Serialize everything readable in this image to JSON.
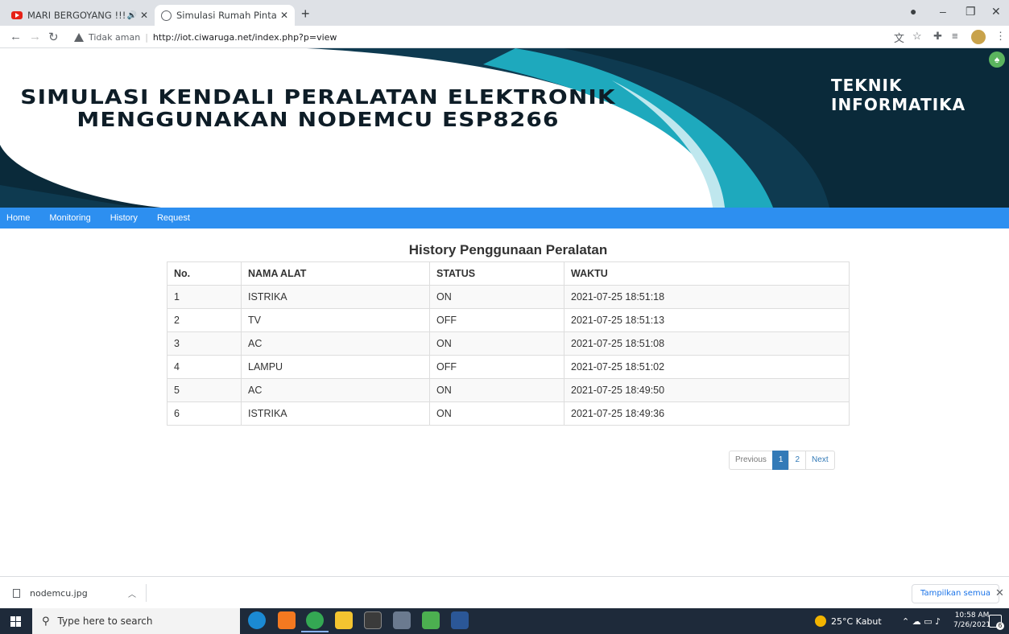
{
  "browser": {
    "tabs": [
      {
        "title": "MARI BERGOYANG !!! KOMP",
        "icon": "youtube-icon",
        "audio": true
      },
      {
        "title": "Simulasi Rumah Pintar Dengan N",
        "icon": "globe-icon",
        "active": true
      }
    ],
    "security_label": "Tidak aman",
    "url": "http://iot.ciwaruga.net/index.php?p=view"
  },
  "header": {
    "title_line1": "SIMULASI KENDALI PERALATAN ELEKTRONIK",
    "title_line2": "MENGGUNAKAN NODEMCU ESP8266",
    "brand_line1": "TEKNIK",
    "brand_line2": "INFORMATIKA",
    "colors": {
      "navy": "#0e3a50",
      "teal": "#1ea9bd",
      "dark": "#0a2a3a"
    }
  },
  "menu": {
    "items": [
      "Home",
      "Monitoring",
      "History",
      "Request"
    ],
    "color": "#2d8ff0"
  },
  "history": {
    "title": "History Penggunaan Peralatan",
    "columns": [
      "No.",
      "NAMA ALAT",
      "STATUS",
      "WAKTU"
    ],
    "rows": [
      [
        "1",
        "ISTRIKA",
        "ON",
        "2021-07-25 18:51:18"
      ],
      [
        "2",
        "TV",
        "OFF",
        "2021-07-25 18:51:13"
      ],
      [
        "3",
        "AC",
        "ON",
        "2021-07-25 18:51:08"
      ],
      [
        "4",
        "LAMPU",
        "OFF",
        "2021-07-25 18:51:02"
      ],
      [
        "5",
        "AC",
        "ON",
        "2021-07-25 18:49:50"
      ],
      [
        "6",
        "ISTRIKA",
        "ON",
        "2021-07-25 18:49:36"
      ]
    ]
  },
  "pagination": {
    "previous": "Previous",
    "pages": [
      "1",
      "2"
    ],
    "current": "1",
    "next": "Next"
  },
  "downloads": {
    "file": "nodemcu.jpg",
    "show_all": "Tampilkan semua"
  },
  "taskbar": {
    "search_placeholder": "Type here to search",
    "weather": "25°C  Kabut",
    "time": "10:58 AM",
    "date": "7/26/2021",
    "notification_count": "6"
  }
}
